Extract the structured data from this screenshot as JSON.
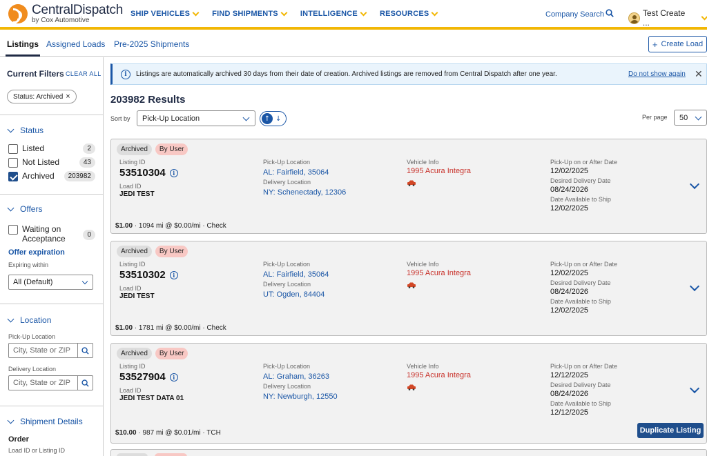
{
  "brand": {
    "name": "CentralDispatch",
    "sub": "by Cox Automotive"
  },
  "nav": {
    "items": [
      "SHIP VEHICLES",
      "FIND SHIPMENTS",
      "INTELLIGENCE",
      "RESOURCES"
    ],
    "company_search": "Company Search",
    "user_name": "Test Create ..."
  },
  "tabs": [
    "Listings",
    "Assigned Loads",
    "Pre-2025 Shipments"
  ],
  "create_load": "Create Load",
  "sidebar": {
    "current_filters": "Current Filters",
    "clear_all": "CLEAR ALL",
    "chip": "Status: Archived",
    "status": {
      "title": "Status",
      "options": [
        {
          "label": "Listed",
          "count": "2",
          "checked": false
        },
        {
          "label": "Not Listed",
          "count": "43",
          "checked": false
        },
        {
          "label": "Archived",
          "count": "203982",
          "checked": true
        }
      ]
    },
    "offers": {
      "title": "Offers",
      "waiting_label": "Waiting on Acceptance",
      "waiting_count": "0",
      "expiration_title": "Offer expiration",
      "expiring_within": "Expiring within",
      "expiring_value": "All (Default)"
    },
    "location": {
      "title": "Location",
      "pickup_label": "Pick-Up Location",
      "delivery_label": "Delivery Location",
      "placeholder": "City, State or ZIP"
    },
    "shipment": {
      "title": "Shipment Details",
      "order": "Order",
      "order_sub": "Load ID or Listing ID"
    }
  },
  "banner": {
    "text": "Listings are automatically archived 30 days from their date of creation. Archived listings are removed from Central Dispatch after one year.",
    "dismiss": "Do not show again"
  },
  "results": "203982 Results",
  "sort": {
    "label": "Sort by",
    "value": "Pick-Up Location"
  },
  "per_page": {
    "label": "Per page",
    "value": "50"
  },
  "labels": {
    "listing_id": "Listing ID",
    "load_id": "Load ID",
    "pickup_location": "Pick-Up Location",
    "delivery_location": "Delivery Location",
    "vehicle_info": "Vehicle Info",
    "pickup_date": "Pick-Up on or After Date",
    "delivery_date": "Desired Delivery Date",
    "available_date": "Date Available to Ship",
    "duplicate": "Duplicate Listing"
  },
  "listings": [
    {
      "badges": [
        "Archived",
        "By User"
      ],
      "listing_id": "53510304",
      "load_id": "JEDI TEST",
      "pickup": "AL: Fairfield, 35064",
      "delivery": "NY: Schenectady, 12306",
      "vehicle": "1995 Acura Integra",
      "pickup_date": "12/02/2025",
      "delivery_date": "08/24/2026",
      "available_date": "12/02/2025",
      "price": "$1.00",
      "price_detail": " · 1094 mi @ $0.00/mi · Check"
    },
    {
      "badges": [
        "Archived",
        "By User"
      ],
      "listing_id": "53510302",
      "load_id": "JEDI TEST",
      "pickup": "AL: Fairfield, 35064",
      "delivery": "UT: Ogden, 84404",
      "vehicle": "1995 Acura Integra",
      "pickup_date": "12/02/2025",
      "delivery_date": "08/24/2026",
      "available_date": "12/02/2025",
      "price": "$1.00",
      "price_detail": " · 1781 mi @ $0.00/mi · Check"
    },
    {
      "badges": [
        "Archived",
        "By User"
      ],
      "listing_id": "53527904",
      "load_id": "JEDI TEST DATA 01",
      "pickup": "AL: Graham, 36263",
      "delivery": "NY: Newburgh, 12550",
      "vehicle": "1995 Acura Integra",
      "pickup_date": "12/12/2025",
      "delivery_date": "08/24/2026",
      "available_date": "12/12/2025",
      "price": "$10.00",
      "price_detail": " · 987 mi @ $0.01/mi · TCH"
    }
  ]
}
